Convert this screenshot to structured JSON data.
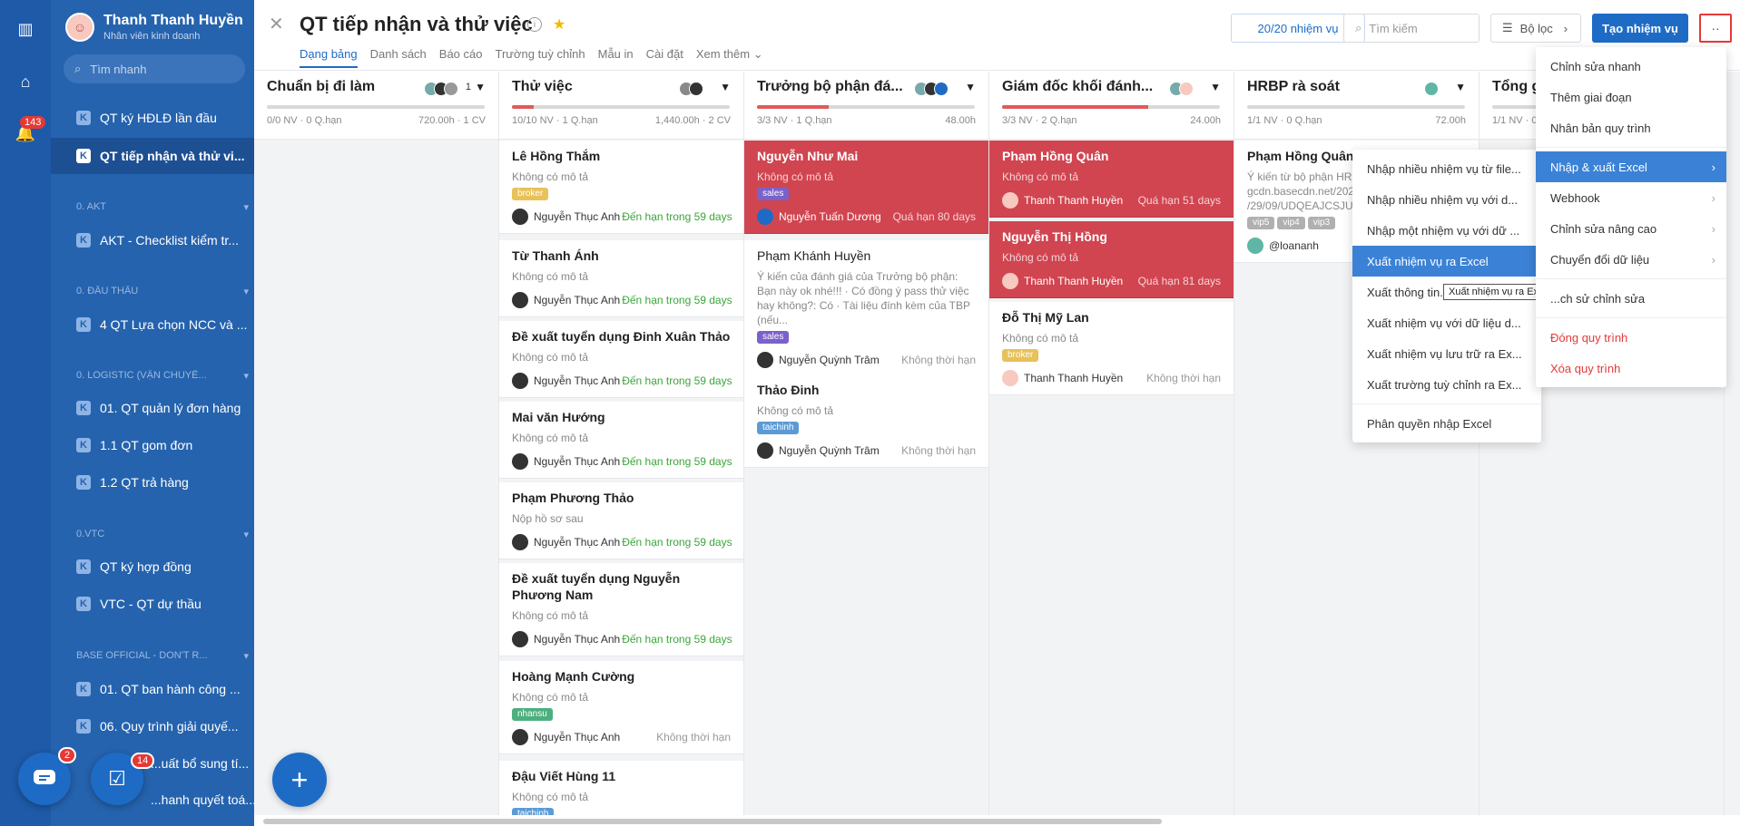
{
  "rail": {
    "notif_count": "143"
  },
  "sidebar": {
    "user_name": "Thanh Thanh Huyền",
    "user_role": "Nhân viên kinh doanh",
    "search_placeholder": "Tìm nhanh",
    "items": [
      {
        "label": "QT ký HĐLĐ lần đầu"
      },
      {
        "label": "QT tiếp nhận và thử vi..."
      },
      {
        "label": "AKT - Checklist kiểm tr..."
      },
      {
        "label": "4 QT Lựa chọn NCC và ..."
      },
      {
        "label": "01. QT quản lý đơn hàng"
      },
      {
        "label": "1.1 QT gom đơn"
      },
      {
        "label": "1.2 QT trả hàng"
      },
      {
        "label": "QT ký hợp đồng"
      },
      {
        "label": "VTC - QT dự thầu"
      },
      {
        "label": "01. QT ban hành công ..."
      },
      {
        "label": "06. Quy trình giải quyế..."
      },
      {
        "label": "...uất bổ sung tí..."
      },
      {
        "label": "...hanh quyết toá..."
      }
    ],
    "groups": [
      "0. AKT",
      "0. ĐẤU THẦU",
      "0. LOGISTIC (VẬN CHUYỂ...",
      "0.VTC",
      "BASE OFFICIAL - DON'T R..."
    ],
    "chat_badge": "2",
    "task_badge": "14"
  },
  "header": {
    "title": "QT tiếp nhận và thử việc",
    "tabs": [
      "Dạng bảng",
      "Danh sách",
      "Báo cáo",
      "Trường tuỳ chỉnh",
      "Mẫu in",
      "Cài đặt",
      "Xem thêm"
    ],
    "task_count": "20/20 nhiệm vụ",
    "search_placeholder": "Tìm kiếm",
    "filter_label": "Bộ lọc",
    "create_label": "Tạo nhiệm vụ",
    "more_label": "··"
  },
  "columns": [
    {
      "title": "Chuẩn bị đi làm",
      "count": "1",
      "meta": "0/0 NV · 0 Q.hạn",
      "meta_r": "720.00h · 1 CV",
      "progress": 0
    },
    {
      "title": "Thử việc",
      "count": "",
      "meta": "10/10 NV · 1 Q.hạn",
      "meta_r": "1,440.00h · 2 CV",
      "progress": 0.1
    },
    {
      "title": "Trưởng bộ phận đá...",
      "count": "",
      "meta": "3/3 NV · 1 Q.hạn",
      "meta_r": "48.00h",
      "progress": 0.33
    },
    {
      "title": "Giám đốc khối đánh...",
      "count": "",
      "meta": "3/3 NV · 2 Q.hạn",
      "meta_r": "24.00h",
      "progress": 0.67
    },
    {
      "title": "HRBP rà soát",
      "count": "",
      "meta": "1/1 NV · 0 Q.hạn",
      "meta_r": "72.00h",
      "progress": 0
    },
    {
      "title": "Tổng g...",
      "count": "",
      "meta": "1/1 NV · 0",
      "meta_r": "",
      "progress": 0
    }
  ],
  "cards_col2": [
    {
      "title": "Lê Hồng Thắm",
      "desc": "Không có mô tả",
      "tag": "broker",
      "who": "Nguyễn Thục Anh",
      "due": "Đến hạn trong 59 days"
    },
    {
      "title": "Từ Thanh Ánh",
      "desc": "Không có mô tả",
      "tag": "",
      "who": "Nguyễn Thục Anh",
      "due": "Đến hạn trong 59 days"
    },
    {
      "title": "Đề xuất tuyển dụng Đinh Xuân Thảo",
      "desc": "Không có mô tả",
      "tag": "",
      "who": "Nguyễn Thục Anh",
      "due": "Đến hạn trong 59 days"
    },
    {
      "title": "Mai văn Hướng",
      "desc": "Không có mô tả",
      "tag": "",
      "who": "Nguyễn Thục Anh",
      "due": "Đến hạn trong 59 days"
    },
    {
      "title": "Phạm Phương Thảo",
      "desc": "Nộp hồ sơ sau",
      "tag": "",
      "who": "Nguyễn Thục Anh",
      "due": "Đến hạn trong 59 days"
    },
    {
      "title": "Đề xuất tuyển dụng Nguyễn Phương Nam",
      "desc": "Không có mô tả",
      "tag": "",
      "who": "Nguyễn Thục Anh",
      "due": "Đến hạn trong 59 days"
    },
    {
      "title": "Hoàng Mạnh Cường",
      "desc": "Không có mô tả",
      "tag": "nhansu",
      "who": "Nguyễn Thục Anh",
      "due": "Không thời hạn"
    },
    {
      "title": "Đậu Viết Hùng 11",
      "desc": "Không có mô tả",
      "tag": "taichinh",
      "who": "",
      "due": ""
    }
  ],
  "cards_col3": [
    {
      "title": "Nguyễn Như Mai",
      "desc": "Không có mô tả",
      "tag": "sales",
      "who": "Nguyễn Tuấn Dương",
      "due": "Quá hạn 80 days"
    },
    {
      "title": "Phạm Khánh Huyền",
      "desc": "Ý kiến của đánh giá của Trưởng bộ phận: Bạn này ok nhé!!! · Có đồng ý pass thử việc hay không?: Có · Tài liệu đính kèm của TBP (nếu...",
      "tag": "sales",
      "who": "Nguyễn Quỳnh Trâm",
      "due": "Không thời hạn"
    },
    {
      "title": "Thảo Đinh",
      "desc": "Không có mô tả",
      "tag": "taichinh",
      "who": "Nguyễn Quỳnh Trâm",
      "due": "Không thời hạn"
    }
  ],
  "cards_col4": [
    {
      "title": "Phạm Hồng Quân",
      "desc": "Không có mô tả",
      "who": "Thanh Thanh Huyền",
      "due": "Quá hạn 51 days"
    },
    {
      "title": "Nguyễn Thị Hồng",
      "desc": "Không có mô tả",
      "who": "Thanh Thanh Huyền",
      "due": "Quá hạn 81 days"
    },
    {
      "title": "Đỗ Thị Mỹ Lan",
      "desc": "Không có mô tả",
      "tag": "broker",
      "who": "Thanh Thanh Huyền",
      "due": "Không thời hạn"
    }
  ],
  "cards_col5": [
    {
      "title": "Phạm Hồng Quân",
      "desc": "Ý kiến từ bộ phận HR:... gcdn.basecdn.net/202... /29/09/UDQEAJCSJU/...",
      "tags": [
        "vip5",
        "vip4",
        "vip3"
      ],
      "who": "@loananh"
    }
  ],
  "more_menu": [
    {
      "label": "Chỉnh sửa nhanh"
    },
    {
      "label": "Thêm giai đoạn"
    },
    {
      "label": "Nhân bản quy trình"
    },
    {
      "label": "Nhập & xuất Excel"
    },
    {
      "label": "Webhook"
    },
    {
      "label": "Chỉnh sửa nâng cao"
    },
    {
      "label": "Chuyển đổi dữ liệu"
    },
    {
      "label": "...ch sử chỉnh sửa"
    },
    {
      "label": "Đóng quy trình"
    },
    {
      "label": "Xóa quy trình"
    }
  ],
  "excel_menu": [
    {
      "label": "Nhập nhiều nhiệm vụ từ file..."
    },
    {
      "label": "Nhập nhiều nhiệm vụ với d..."
    },
    {
      "label": "Nhập một nhiệm vụ với dữ ..."
    },
    {
      "label": "Xuất nhiệm vụ ra Excel"
    },
    {
      "label": "Xuất thông tin..."
    },
    {
      "label": "Xuất nhiệm vụ với dữ liệu d..."
    },
    {
      "label": "Xuất nhiệm vụ lưu trữ ra Ex..."
    },
    {
      "label": "Xuất trường tuỳ chỉnh ra Ex..."
    },
    {
      "label": "Phân quyền nhập Excel"
    }
  ],
  "tooltip": "Xuất nhiệm vụ ra Excel",
  "tag_colors": {
    "broker": "#e8c15a",
    "sales": "#7b61c9",
    "nhansu": "#4caf7d",
    "taichinh": "#5b9bd5",
    "vip": "#b0b0b0"
  }
}
